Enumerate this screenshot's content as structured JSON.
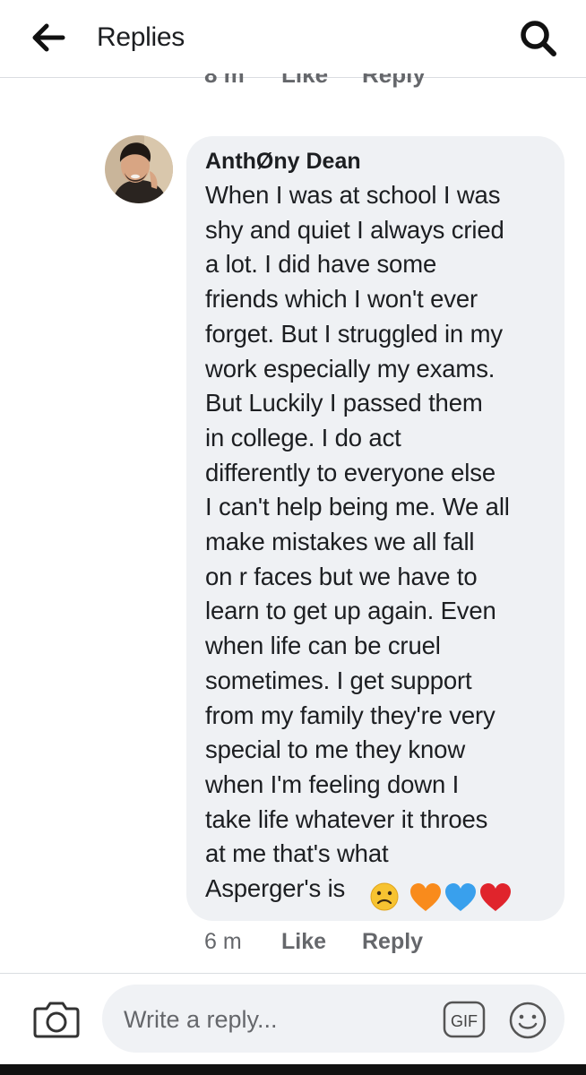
{
  "header": {
    "title": "Replies",
    "back_icon": "back-arrow-icon",
    "search_icon": "search-icon"
  },
  "previous_comment": {
    "time": "8 m",
    "like_label": "Like",
    "reply_label": "Reply"
  },
  "comment": {
    "author": "AnthØny Dean",
    "lines": [
      "When I was at school I was",
      "shy and quiet I always cried",
      "a lot. I did have some",
      "friends which I won't ever",
      "forget. But I struggled in my",
      "work especially my exams.",
      "But Luckily I passed them",
      "in college. I do act",
      "differently to everyone else",
      "I can't help being me. We all",
      "make mistakes we all fall",
      "on r faces but we have to",
      "learn to get up again. Even",
      "when life can be cruel",
      "sometimes. I get support",
      "from my family they're very",
      "special to me they know",
      "when I'm feeling down I",
      "take life whatever it throes",
      "at me that's what",
      "Asperger's is"
    ],
    "emojis": [
      "confused-face",
      "orange-heart",
      "blue-heart",
      "red-heart"
    ],
    "time": "6 m",
    "like_label": "Like",
    "reply_label": "Reply"
  },
  "composer": {
    "placeholder": "Write a reply...",
    "camera_icon": "camera-icon",
    "gif_label": "GIF",
    "emoji_icon": "smiley-icon"
  },
  "colors": {
    "bubble": "#eff1f4",
    "meta_text": "#65676b",
    "orange_heart": "#f98b1c",
    "blue_heart": "#39a0ed",
    "red_heart": "#e0242c",
    "emoji_yellow": "#f7c331"
  }
}
